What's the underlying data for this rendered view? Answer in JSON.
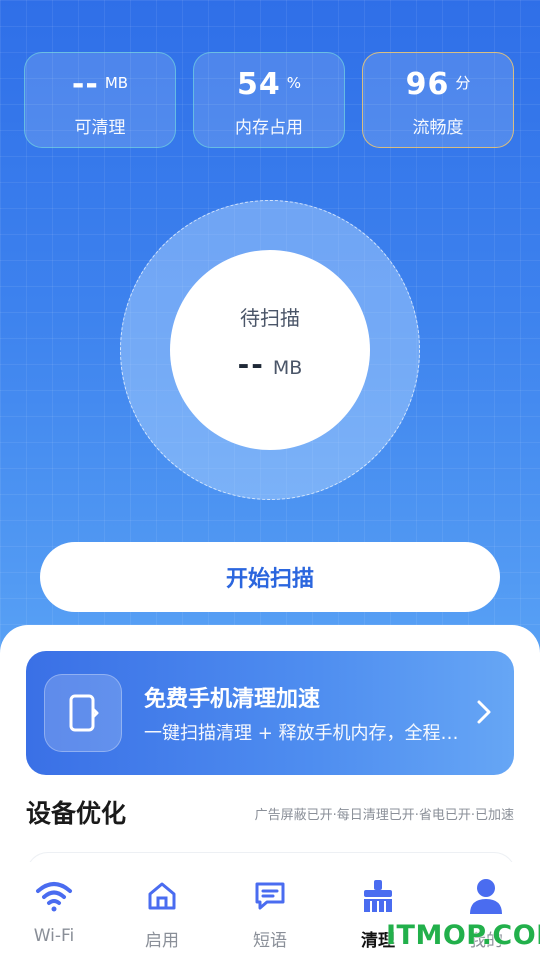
{
  "stats": [
    {
      "value": "--",
      "unit": "MB",
      "label": "可清理"
    },
    {
      "value": "54",
      "unit": "%",
      "label": "内存占用"
    },
    {
      "value": "96",
      "unit": "分",
      "label": "流畅度"
    }
  ],
  "scan_circle": {
    "status": "待扫描",
    "amount": "--",
    "unit": "MB"
  },
  "scan_button": "开始扫描",
  "promo": {
    "title": "免费手机清理加速",
    "desc": "一键扫描清理 + 释放手机内存，全程…",
    "icon": "phone-icon"
  },
  "device_section": {
    "title": "设备优化",
    "status": "广告屏蔽已开·每日清理已开·省电已开·已加速"
  },
  "tabs": [
    {
      "label": "Wi-Fi",
      "icon": "wifi-icon"
    },
    {
      "label": "启用",
      "icon": "home-icon"
    },
    {
      "label": "短语",
      "icon": "chat-icon"
    },
    {
      "label": "清理",
      "icon": "broom-icon",
      "active": true
    },
    {
      "label": "我的",
      "icon": "user-icon"
    }
  ],
  "watermark": "ITMOP.COM",
  "colors": {
    "primary": "#2f6fe8",
    "accent_text": "#2b66de",
    "tab_icon": "#4a6cf0",
    "watermark": "#22b04b"
  }
}
